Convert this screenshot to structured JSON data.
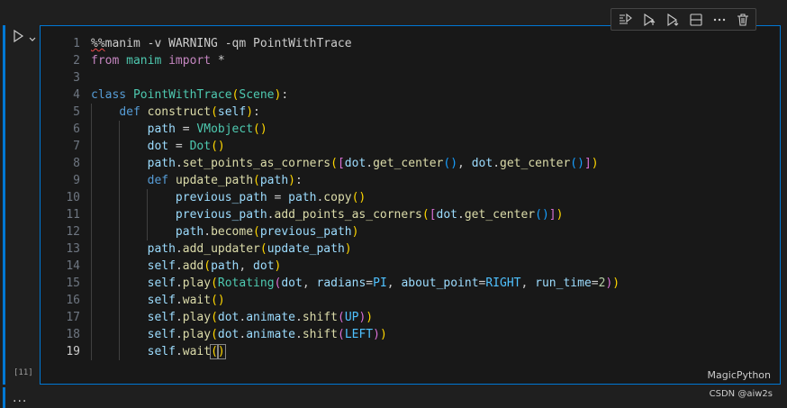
{
  "toolbar": {
    "buttons": [
      {
        "name": "run-by-line-icon"
      },
      {
        "name": "execute-above-icon"
      },
      {
        "name": "execute-below-icon"
      },
      {
        "name": "split-cell-icon"
      },
      {
        "name": "more-icon"
      },
      {
        "name": "delete-icon"
      }
    ]
  },
  "cell": {
    "execution_count": "[11]",
    "language": "MagicPython",
    "active_line": 19
  },
  "code_lines": [
    "%%manim -v WARNING -qm PointWithTrace",
    "from manim import *",
    "",
    "class PointWithTrace(Scene):",
    "    def construct(self):",
    "        path = VMobject()",
    "        dot = Dot()",
    "        path.set_points_as_corners([dot.get_center(), dot.get_center()])",
    "        def update_path(path):",
    "            previous_path = path.copy()",
    "            previous_path.add_points_as_corners([dot.get_center()])",
    "            path.become(previous_path)",
    "        path.add_updater(update_path)",
    "        self.add(path, dot)",
    "        self.play(Rotating(dot, radians=PI, about_point=RIGHT, run_time=2))",
    "        self.wait()",
    "        self.play(dot.animate.shift(UP))",
    "        self.play(dot.animate.shift(LEFT))",
    "        self.wait()"
  ],
  "footer": {
    "ellipsis": "...",
    "watermark": "CSDN @aiw2s"
  },
  "colors": {
    "accent": "#0078d4",
    "background": "#1f1f1f",
    "editor_bg": "#181818"
  }
}
